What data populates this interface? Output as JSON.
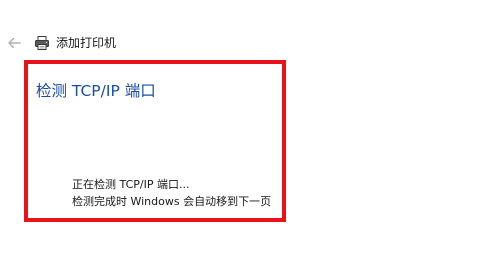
{
  "header": {
    "back_icon": "back-arrow-icon",
    "printer_icon": "printer-icon",
    "title": "添加打印机"
  },
  "main": {
    "heading": "检测 TCP/IP 端口",
    "status_line_1": "正在检测 TCP/IP 端口...",
    "status_line_2": "检测完成时 Windows 会自动移到下一页"
  },
  "colors": {
    "heading": "#1a4fa0",
    "highlight_frame": "#e8121b",
    "back_icon": "#b0b0b0"
  }
}
